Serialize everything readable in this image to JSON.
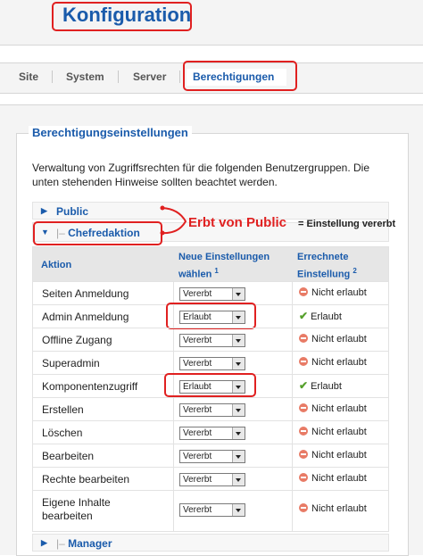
{
  "header": {
    "title": "Konfiguration"
  },
  "tabs": [
    {
      "label": "Site",
      "active": false
    },
    {
      "label": "System",
      "active": false
    },
    {
      "label": "Server",
      "active": false
    },
    {
      "label": "Berechtigungen",
      "active": true
    }
  ],
  "panel": {
    "legend": "Berechtigungseinstellungen",
    "description": "Verwaltung von Zugriffsrechten für die folgenden Benutzergruppen. Die unten stehenden Hinweise sollten beachtet werden."
  },
  "groups": {
    "public": "Public",
    "chefredaktion": "Chefredaktion",
    "manager": "Manager",
    "pipe": "|–"
  },
  "annotation": {
    "inherits": "Erbt von Public",
    "equals": "= Einstellung vererbt"
  },
  "table": {
    "col_action": "Aktion",
    "col_new_line1": "Neue Einstellungen",
    "col_new_line2": "wählen",
    "col_new_sup": "1",
    "col_calc_line1": "Errechnete",
    "col_calc_line2": "Einstellung",
    "col_calc_sup": "2",
    "rows": [
      {
        "action": "Seiten Anmeldung",
        "setting": "Vererbt",
        "result": "Nicht erlaubt"
      },
      {
        "action": "Admin Anmeldung",
        "setting": "Erlaubt",
        "result": "Erlaubt"
      },
      {
        "action": "Offline Zugang",
        "setting": "Vererbt",
        "result": "Nicht erlaubt"
      },
      {
        "action": "Superadmin",
        "setting": "Vererbt",
        "result": "Nicht erlaubt"
      },
      {
        "action": "Komponentenzugriff",
        "setting": "Erlaubt",
        "result": "Erlaubt"
      },
      {
        "action": "Erstellen",
        "setting": "Vererbt",
        "result": "Nicht erlaubt"
      },
      {
        "action": "Löschen",
        "setting": "Vererbt",
        "result": "Nicht erlaubt"
      },
      {
        "action": "Bearbeiten",
        "setting": "Vererbt",
        "result": "Nicht erlaubt"
      },
      {
        "action": "Rechte bearbeiten",
        "setting": "Vererbt",
        "result": "Nicht erlaubt"
      },
      {
        "action_line1": "Eigene Inhalte",
        "action_line2": "bearbeiten",
        "setting": "Vererbt",
        "result": "Nicht erlaubt"
      }
    ]
  },
  "icons": {
    "expand_arrow": "triangle-right-icon",
    "collapse_arrow": "triangle-down-icon",
    "deny": "deny-icon",
    "allow": "checkmark-icon",
    "select": "dropdown-arrow-icon"
  },
  "colors": {
    "accent": "#1a5bab",
    "annotation": "#e02020",
    "allow": "#56a02c",
    "deny": "#e87b66"
  }
}
